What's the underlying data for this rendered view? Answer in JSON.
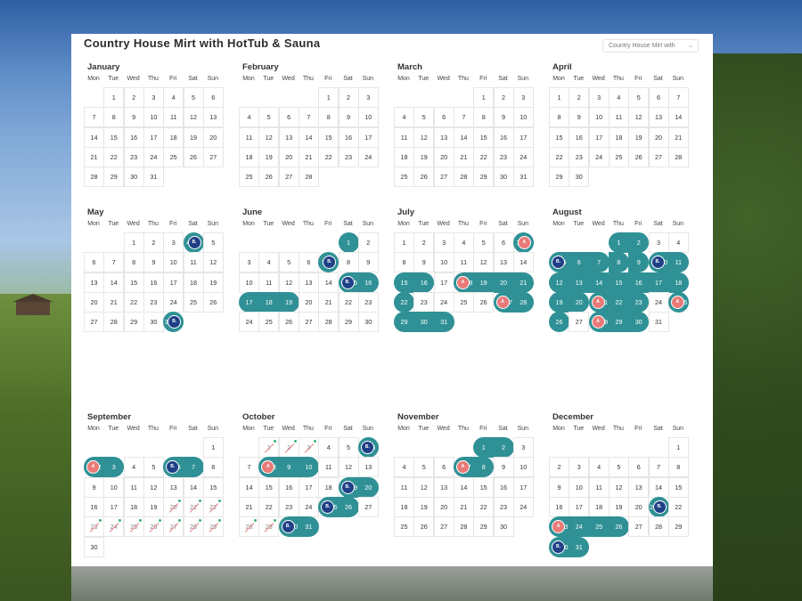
{
  "title": "Country House Mirt with HotTub & Sauna",
  "selector": {
    "value": "Country House Mirt with"
  },
  "weekdays": [
    "Mon",
    "Tue",
    "Wed",
    "Thu",
    "Fri",
    "Sat",
    "Sun"
  ],
  "colors": {
    "booking": "#2f9196",
    "badge_b": "#1f3f86",
    "badge_a": "#e97a78"
  },
  "months": [
    {
      "name": "January",
      "offset": 1,
      "days": 31,
      "bookings": []
    },
    {
      "name": "February",
      "offset": 4,
      "days": 28,
      "bookings": []
    },
    {
      "name": "March",
      "offset": 4,
      "days": 31,
      "bookings": []
    },
    {
      "name": "April",
      "offset": 0,
      "days": 30,
      "bookings": []
    },
    {
      "name": "May",
      "offset": 2,
      "days": 31,
      "bookings": [
        {
          "days": [
            4
          ],
          "badge": "B.",
          "badgeSide": "right",
          "bstart": 4
        },
        {
          "days": [
            31
          ],
          "badge": "B.",
          "badgeSide": "right",
          "bstart": 31
        }
      ]
    },
    {
      "name": "June",
      "offset": 5,
      "days": 30,
      "bookings": [
        {
          "days": [
            1
          ],
          "badge": ""
        },
        {
          "days": [
            7
          ],
          "badge": "B.",
          "badgeSide": "right"
        },
        {
          "days": [
            15,
            16
          ],
          "badge": "B.",
          "badgeSide": "left"
        },
        {
          "days": [
            17,
            18,
            19
          ],
          "badge": ""
        }
      ]
    },
    {
      "name": "July",
      "offset": 0,
      "days": 31,
      "bookings": [
        {
          "days": [
            7
          ],
          "badge": "A",
          "badgeSide": "right"
        },
        {
          "days": [
            15,
            16
          ],
          "badge": ""
        },
        {
          "days": [
            18,
            19,
            20,
            21
          ],
          "badge": "A",
          "badgeSide": "left"
        },
        {
          "days": [
            22
          ],
          "badge": ""
        },
        {
          "days": [
            27,
            28
          ],
          "badge": "A",
          "badgeSide": "left"
        },
        {
          "days": [
            29,
            30,
            31
          ],
          "badge": ""
        }
      ]
    },
    {
      "name": "August",
      "offset": 3,
      "days": 31,
      "bookings": [
        {
          "days": [
            1,
            2
          ],
          "badge": ""
        },
        {
          "days": [
            5,
            6,
            7
          ],
          "badge": "B.",
          "badgeSide": "left"
        },
        {
          "days": [
            6,
            7,
            8
          ],
          "badge": "B.",
          "badgeSide": "left",
          "row": "r2b"
        },
        {
          "days": [
            7,
            8,
            9
          ],
          "badge": "B.",
          "badgeSide": "left",
          "row": "r2c"
        },
        {
          "days": [
            10,
            11
          ],
          "badge": "B.",
          "badgeSide": "left"
        },
        {
          "days": [
            12,
            13,
            14,
            15,
            16,
            17,
            18
          ],
          "badge": ""
        },
        {
          "days": [
            19,
            20
          ],
          "badge": ""
        },
        {
          "days": [
            21,
            22,
            23
          ],
          "badge": "A",
          "badgeSide": "left"
        },
        {
          "days": [
            25
          ],
          "badge": "A",
          "badgeSide": "left"
        },
        {
          "days": [
            26
          ],
          "badge": ""
        },
        {
          "days": [
            28,
            29,
            30
          ],
          "badge": "A",
          "badgeSide": "left"
        }
      ]
    },
    {
      "name": "September",
      "offset": 6,
      "days": 30,
      "bookings": [
        {
          "days": [
            2,
            3
          ],
          "badge": "A",
          "badgeSide": "left"
        },
        {
          "days": [
            6,
            7
          ],
          "badge": "B.",
          "badgeSide": "left"
        }
      ],
      "struck": [
        20,
        21,
        22,
        23,
        24,
        25,
        26,
        27,
        28,
        29
      ]
    },
    {
      "name": "October",
      "offset": 1,
      "days": 31,
      "bookings": [
        {
          "days": [
            6
          ],
          "badge": "B.",
          "badgeSide": "left"
        },
        {
          "days": [
            8,
            9,
            10
          ],
          "badge": "A",
          "badgeSide": "left"
        },
        {
          "days": [
            19,
            20
          ],
          "badge": "B.",
          "badgeSide": "left"
        },
        {
          "days": [
            25,
            26
          ],
          "badge": "B.",
          "badgeSide": "left"
        },
        {
          "days": [
            30,
            31
          ],
          "badge": "B.",
          "badgeSide": "left"
        }
      ],
      "struck": [
        1,
        2,
        3,
        28,
        29
      ]
    },
    {
      "name": "November",
      "offset": 4,
      "days": 30,
      "bookings": [
        {
          "days": [
            1,
            2
          ],
          "badge": ""
        },
        {
          "days": [
            7,
            8
          ],
          "badge": "A",
          "badgeSide": "left"
        }
      ]
    },
    {
      "name": "December",
      "offset": 6,
      "days": 31,
      "bookings": [
        {
          "days": [
            21
          ],
          "badge": "B.",
          "badgeSide": "right"
        },
        {
          "days": [
            23,
            24,
            25,
            26
          ],
          "badge": "A",
          "badgeSide": "left"
        },
        {
          "days": [
            30,
            31
          ],
          "badge": "B.",
          "badgeSide": "left"
        }
      ]
    }
  ]
}
